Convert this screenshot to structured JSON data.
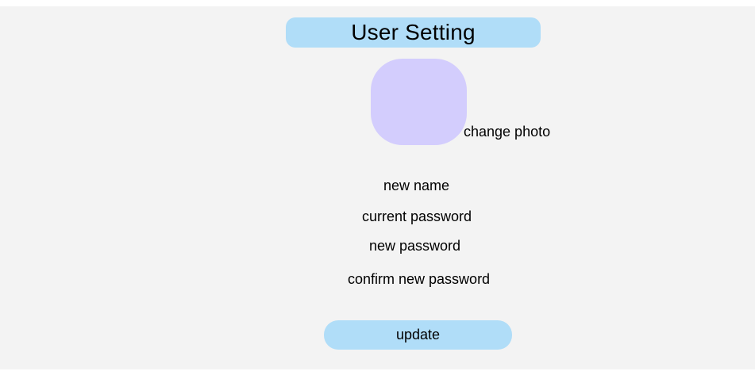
{
  "header": {
    "title": "User Setting"
  },
  "profile": {
    "avatar_color": "#d3cdfd",
    "change_photo_label": "change photo"
  },
  "form": {
    "new_name_label": "new name",
    "current_password_label": "current password",
    "new_password_label": "new password",
    "confirm_password_label": "confirm new password"
  },
  "actions": {
    "update_label": "update"
  },
  "colors": {
    "accent": "#b0ddf8",
    "background": "#f3f3f3"
  }
}
